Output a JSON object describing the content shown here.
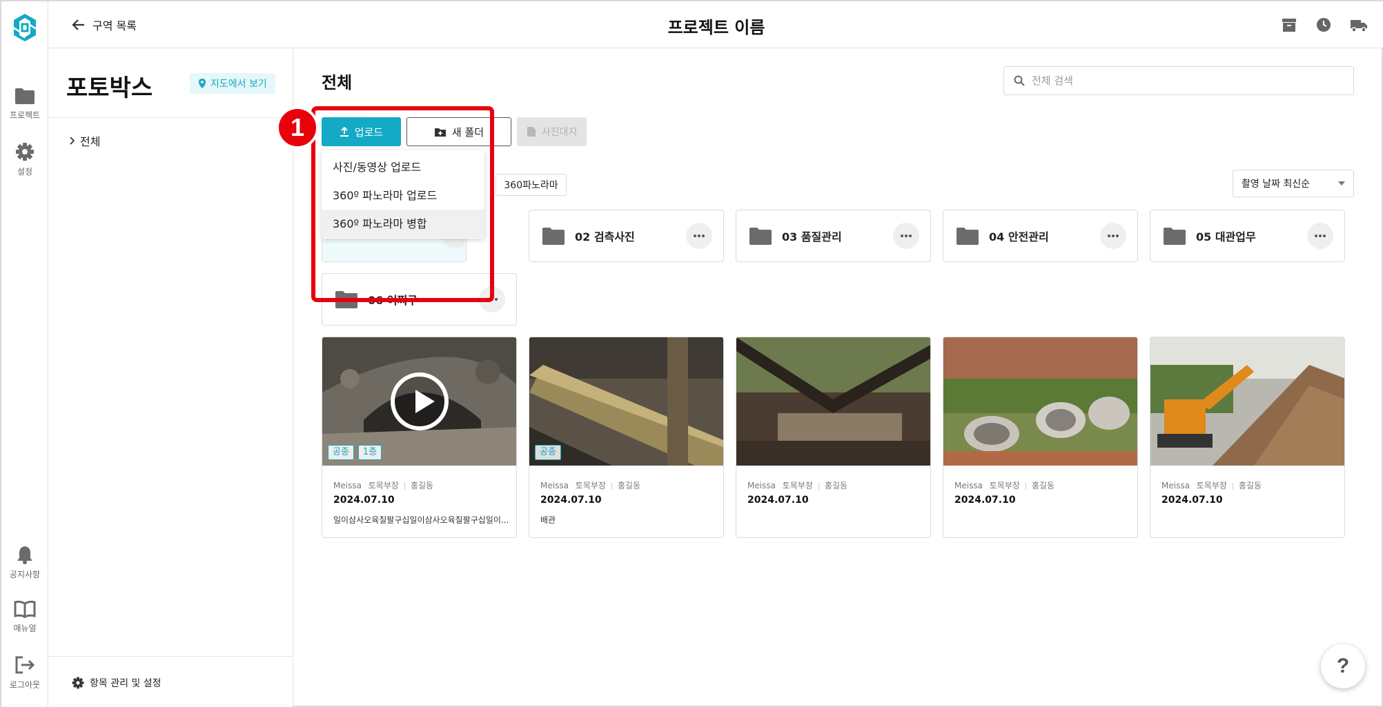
{
  "topbar": {
    "back_label": "구역 목록",
    "title": "프로젝트 이름",
    "icons": [
      "archive-icon",
      "clock-icon",
      "truck-icon"
    ]
  },
  "rail": {
    "items": [
      {
        "label": "프로젝트",
        "icon": "folder-icon"
      },
      {
        "label": "설정",
        "icon": "gear-icon"
      },
      {
        "label": "공지사항",
        "icon": "bell-icon"
      },
      {
        "label": "매뉴얼",
        "icon": "book-icon"
      },
      {
        "label": "로그아웃",
        "icon": "logout-icon"
      }
    ]
  },
  "tree": {
    "title": "포토박스",
    "map_button": "지도에서 보기",
    "nodes": [
      {
        "label": "전체"
      }
    ],
    "settings_label": "항목 관리 및 설정"
  },
  "main": {
    "title": "전체",
    "search_placeholder": "전체 검색",
    "upload_label": "업로드",
    "new_folder_label": "새 폴더",
    "photo_sheet_label": "사진대지",
    "filter_chip": "360파노라마",
    "sort_label": "촬영 날짜 최신순"
  },
  "dropdown": {
    "items": [
      {
        "label": "사진/동영상 업로드"
      },
      {
        "label": "360º 파노라마 업로드"
      },
      {
        "label": "360º 파노라마 병합"
      }
    ]
  },
  "annotation": {
    "number": "1",
    "color": "#e8000b"
  },
  "folders": [
    {
      "name": "02 검측사진"
    },
    {
      "name": "03 품질관리"
    },
    {
      "name": "04 안전관리"
    },
    {
      "name": "05 대관업무"
    },
    {
      "name": "06 어쩌구"
    }
  ],
  "photos": [
    {
      "company": "Meissa",
      "role": "토목부장",
      "name": "홍길동",
      "date": "2024.07.10",
      "caption": "일이삼사오육칠팔구십일이삼사오육칠팔구십일이...",
      "tags": [
        "공종",
        "1층"
      ]
    },
    {
      "company": "Meissa",
      "role": "토목부장",
      "name": "홍길동",
      "date": "2024.07.10",
      "caption": "배관",
      "tags": [
        "공종"
      ]
    },
    {
      "company": "Meissa",
      "role": "토목부장",
      "name": "홍길동",
      "date": "2024.07.10",
      "caption": "",
      "tags": []
    },
    {
      "company": "Meissa",
      "role": "토목부장",
      "name": "홍길동",
      "date": "2024.07.10",
      "caption": "",
      "tags": []
    },
    {
      "company": "Meissa",
      "role": "토목부장",
      "name": "홍길동",
      "date": "2024.07.10",
      "caption": "",
      "tags": []
    }
  ],
  "help_label": "?",
  "colors": {
    "accent": "#14a9c4",
    "highlight": "#e8000b"
  }
}
